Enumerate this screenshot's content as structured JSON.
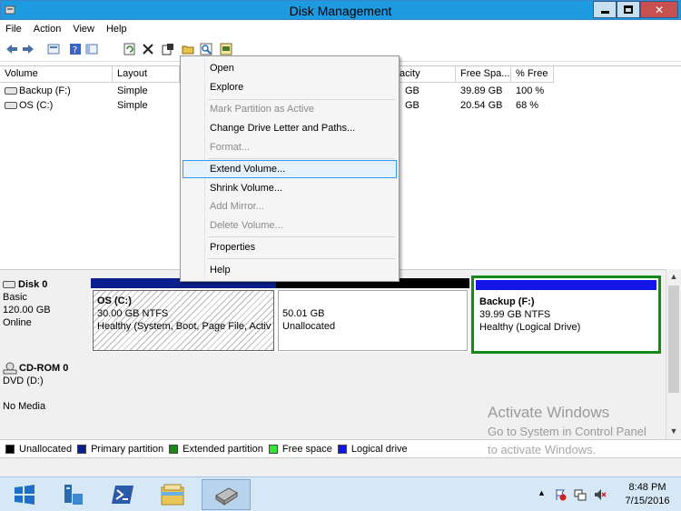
{
  "window": {
    "title": "Disk Management",
    "minimize": "▁",
    "maximize": "🗗",
    "close": "✕"
  },
  "menu": [
    "File",
    "Action",
    "View",
    "Help"
  ],
  "toolbar": [
    "back-icon",
    "forward-icon",
    "list-view-icon",
    "help-icon",
    "pane-icon",
    "refresh-icon",
    "delete-icon",
    "properties-icon",
    "open-icon",
    "search-icon",
    "disk-settings-icon"
  ],
  "volumes": {
    "headers": [
      "Volume",
      "Layout",
      "Capacity",
      "Free Spa...",
      "% Free"
    ],
    "headers_visible": [
      "Volume",
      "Layout",
      "acity",
      "Free Spa...",
      "% Free"
    ],
    "rows": [
      {
        "name": "Backup (F:)",
        "layout": "Simple",
        "capacity_visible": "GB",
        "free": "39.89 GB",
        "pct": "100 %"
      },
      {
        "name": "OS (C:)",
        "layout": "Simple",
        "capacity_visible": "GB",
        "free": "20.54 GB",
        "pct": "68 %"
      }
    ]
  },
  "context_menu": {
    "items": [
      {
        "label": "Open",
        "enabled": true
      },
      {
        "label": "Explore",
        "enabled": true
      },
      {
        "label": "Mark Partition as Active",
        "enabled": false
      },
      {
        "label": "Change Drive Letter and Paths...",
        "enabled": true
      },
      {
        "label": "Format...",
        "enabled": false
      },
      {
        "label": "Extend Volume...",
        "enabled": true,
        "highlighted": true
      },
      {
        "label": "Shrink Volume...",
        "enabled": true
      },
      {
        "label": "Add Mirror...",
        "enabled": false
      },
      {
        "label": "Delete Volume...",
        "enabled": false
      },
      {
        "label": "Properties",
        "enabled": true
      },
      {
        "label": "Help",
        "enabled": true
      }
    ]
  },
  "disks": {
    "disk0": {
      "name": "Disk 0",
      "type": "Basic",
      "size": "120.00 GB",
      "status": "Online",
      "partitions": [
        {
          "name": "OS  (C:)",
          "size": "30.00 GB NTFS",
          "status": "Healthy (System, Boot, Page File, Activ",
          "bar_color": "#0a1e8c",
          "selected": true
        },
        {
          "name": "",
          "size": "50.01 GB",
          "status": "Unallocated",
          "bar_color": "#000000"
        },
        {
          "name": "Backup  (F:)",
          "size": "39.99 GB NTFS",
          "status": "Healthy (Logical Drive)",
          "bar_color": "#1414e6",
          "frame_color": "#168a16"
        }
      ]
    },
    "cdrom0": {
      "name": "CD-ROM 0",
      "type": "DVD (D:)",
      "media": "No Media"
    }
  },
  "watermark": {
    "line1": "Activate Windows",
    "line2": "Go to System in Control Panel",
    "line3": "to activate Windows."
  },
  "legend": [
    {
      "label": "Unallocated",
      "color": "#000000"
    },
    {
      "label": "Primary partition",
      "color": "#0a1e8c"
    },
    {
      "label": "Extended partition",
      "color": "#168a16"
    },
    {
      "label": "Free space",
      "color": "#33e633"
    },
    {
      "label": "Logical drive",
      "color": "#1414e6"
    }
  ],
  "taskbar": {
    "time": "8:48 PM",
    "date": "7/15/2016",
    "items": [
      "start-button",
      "server-manager",
      "powershell",
      "file-explorer",
      "disk-management"
    ]
  }
}
